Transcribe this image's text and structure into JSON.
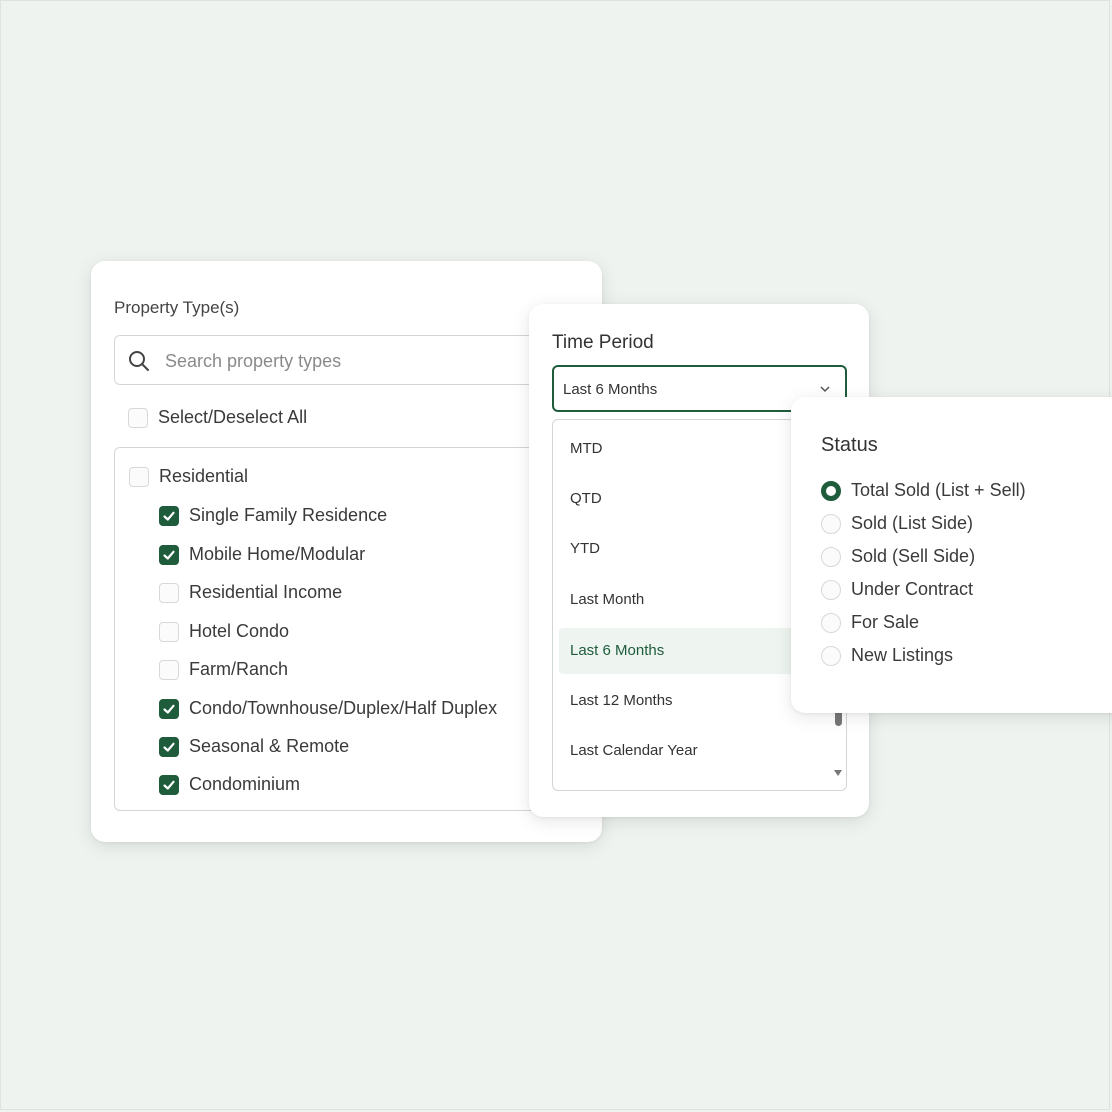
{
  "property_types": {
    "title": "Property Type(s)",
    "search": {
      "placeholder": "Search property types",
      "value": ""
    },
    "select_all_label": "Select/Deselect All",
    "group": {
      "label": "Residential",
      "checked": false
    },
    "items": [
      {
        "label": "Single Family Residence",
        "checked": true
      },
      {
        "label": "Mobile Home/Modular",
        "checked": true
      },
      {
        "label": "Residential Income",
        "checked": false
      },
      {
        "label": "Hotel Condo",
        "checked": false
      },
      {
        "label": "Farm/Ranch",
        "checked": false
      },
      {
        "label": "Condo/Townhouse/Duplex/Half Duplex",
        "checked": true
      },
      {
        "label": "Seasonal & Remote",
        "checked": true
      },
      {
        "label": "Condominium",
        "checked": true
      }
    ]
  },
  "time_period": {
    "title": "Time Period",
    "selected": "Last 6 Months",
    "options": [
      "MTD",
      "QTD",
      "YTD",
      "Last Month",
      "Last 6 Months",
      "Last 12 Months",
      "Last Calendar Year"
    ]
  },
  "status": {
    "title": "Status",
    "options": [
      {
        "label": "Total Sold (List + Sell)",
        "checked": true
      },
      {
        "label": "Sold (List Side)",
        "checked": false
      },
      {
        "label": "Sold (Sell Side)",
        "checked": false
      },
      {
        "label": "Under Contract",
        "checked": false
      },
      {
        "label": "For Sale",
        "checked": false
      },
      {
        "label": "New Listings",
        "checked": false
      }
    ]
  },
  "colors": {
    "accent": "#1e5c3c",
    "background": "#eef3ef",
    "selected_bg": "#eef4ef"
  }
}
